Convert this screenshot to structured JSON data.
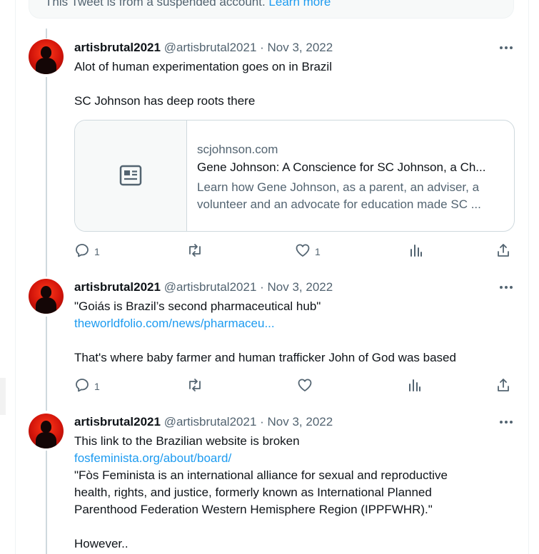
{
  "suspended_notice": {
    "text": "This Tweet is from a suspended account.",
    "link": "Learn more"
  },
  "tweets": [
    {
      "display_name": "artisbrutal2021",
      "handle_date": "@artisbrutal2021 · Nov 3, 2022",
      "lines": [
        "Alot of human experimentation goes on in Brazil",
        "SC Johnson has deep roots there"
      ],
      "card": {
        "domain": "scjohnson.com",
        "title": "Gene Johnson: A Conscience for SC Johnson, a Ch...",
        "desc_line1": "Learn how Gene Johnson, as a parent, an adviser, a",
        "desc_line2": "volunteer and an advocate for education made SC ..."
      },
      "actions": {
        "replies": "1",
        "retweets": "",
        "likes": "1"
      }
    },
    {
      "display_name": "artisbrutal2021",
      "handle_date": "@artisbrutal2021 · Nov 3, 2022",
      "line1": "\"Goiás is Brazil’s second pharmaceutical hub\"",
      "link": "theworldfolio.com/news/pharmaceu...",
      "line2": "That's where baby farmer and human trafficker John of God was based",
      "actions": {
        "replies": "1",
        "retweets": "",
        "likes": ""
      }
    },
    {
      "display_name": "artisbrutal2021",
      "handle_date": "@artisbrutal2021 · Nov 3, 2022",
      "line1": "This link to the Brazilian website is broken",
      "link": "fosfeminista.org/about/board/",
      "quote_lines": [
        "\"Fòs Feminista is an international alliance for sexual and reproductive",
        "health, rights, and justice, formerly known as International Planned",
        "Parenthood Federation Western Hemisphere Region (IPPFWHR).\""
      ],
      "line_last": "However.."
    }
  ],
  "icons": [
    "more-icon",
    "article-icon",
    "reply-icon",
    "retweet-icon",
    "like-icon",
    "views-icon",
    "share-icon"
  ],
  "colors": {
    "text": "#0f1419",
    "secondary": "#536471",
    "link": "#1d9bf0",
    "border": "#cfd9de",
    "avatar": "#d2140a"
  }
}
